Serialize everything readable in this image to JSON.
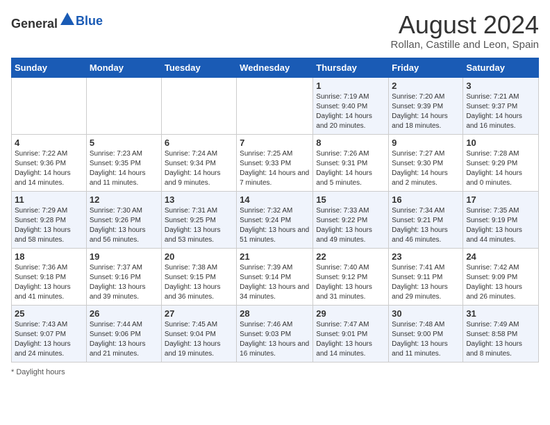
{
  "header": {
    "logo_general": "General",
    "logo_blue": "Blue",
    "month_year": "August 2024",
    "location": "Rollan, Castille and Leon, Spain"
  },
  "days_of_week": [
    "Sunday",
    "Monday",
    "Tuesday",
    "Wednesday",
    "Thursday",
    "Friday",
    "Saturday"
  ],
  "weeks": [
    [
      {
        "day": "",
        "info": ""
      },
      {
        "day": "",
        "info": ""
      },
      {
        "day": "",
        "info": ""
      },
      {
        "day": "",
        "info": ""
      },
      {
        "day": "1",
        "info": "Sunrise: 7:19 AM\nSunset: 9:40 PM\nDaylight: 14 hours and 20 minutes."
      },
      {
        "day": "2",
        "info": "Sunrise: 7:20 AM\nSunset: 9:39 PM\nDaylight: 14 hours and 18 minutes."
      },
      {
        "day": "3",
        "info": "Sunrise: 7:21 AM\nSunset: 9:37 PM\nDaylight: 14 hours and 16 minutes."
      }
    ],
    [
      {
        "day": "4",
        "info": "Sunrise: 7:22 AM\nSunset: 9:36 PM\nDaylight: 14 hours and 14 minutes."
      },
      {
        "day": "5",
        "info": "Sunrise: 7:23 AM\nSunset: 9:35 PM\nDaylight: 14 hours and 11 minutes."
      },
      {
        "day": "6",
        "info": "Sunrise: 7:24 AM\nSunset: 9:34 PM\nDaylight: 14 hours and 9 minutes."
      },
      {
        "day": "7",
        "info": "Sunrise: 7:25 AM\nSunset: 9:33 PM\nDaylight: 14 hours and 7 minutes."
      },
      {
        "day": "8",
        "info": "Sunrise: 7:26 AM\nSunset: 9:31 PM\nDaylight: 14 hours and 5 minutes."
      },
      {
        "day": "9",
        "info": "Sunrise: 7:27 AM\nSunset: 9:30 PM\nDaylight: 14 hours and 2 minutes."
      },
      {
        "day": "10",
        "info": "Sunrise: 7:28 AM\nSunset: 9:29 PM\nDaylight: 14 hours and 0 minutes."
      }
    ],
    [
      {
        "day": "11",
        "info": "Sunrise: 7:29 AM\nSunset: 9:28 PM\nDaylight: 13 hours and 58 minutes."
      },
      {
        "day": "12",
        "info": "Sunrise: 7:30 AM\nSunset: 9:26 PM\nDaylight: 13 hours and 56 minutes."
      },
      {
        "day": "13",
        "info": "Sunrise: 7:31 AM\nSunset: 9:25 PM\nDaylight: 13 hours and 53 minutes."
      },
      {
        "day": "14",
        "info": "Sunrise: 7:32 AM\nSunset: 9:24 PM\nDaylight: 13 hours and 51 minutes."
      },
      {
        "day": "15",
        "info": "Sunrise: 7:33 AM\nSunset: 9:22 PM\nDaylight: 13 hours and 49 minutes."
      },
      {
        "day": "16",
        "info": "Sunrise: 7:34 AM\nSunset: 9:21 PM\nDaylight: 13 hours and 46 minutes."
      },
      {
        "day": "17",
        "info": "Sunrise: 7:35 AM\nSunset: 9:19 PM\nDaylight: 13 hours and 44 minutes."
      }
    ],
    [
      {
        "day": "18",
        "info": "Sunrise: 7:36 AM\nSunset: 9:18 PM\nDaylight: 13 hours and 41 minutes."
      },
      {
        "day": "19",
        "info": "Sunrise: 7:37 AM\nSunset: 9:16 PM\nDaylight: 13 hours and 39 minutes."
      },
      {
        "day": "20",
        "info": "Sunrise: 7:38 AM\nSunset: 9:15 PM\nDaylight: 13 hours and 36 minutes."
      },
      {
        "day": "21",
        "info": "Sunrise: 7:39 AM\nSunset: 9:14 PM\nDaylight: 13 hours and 34 minutes."
      },
      {
        "day": "22",
        "info": "Sunrise: 7:40 AM\nSunset: 9:12 PM\nDaylight: 13 hours and 31 minutes."
      },
      {
        "day": "23",
        "info": "Sunrise: 7:41 AM\nSunset: 9:11 PM\nDaylight: 13 hours and 29 minutes."
      },
      {
        "day": "24",
        "info": "Sunrise: 7:42 AM\nSunset: 9:09 PM\nDaylight: 13 hours and 26 minutes."
      }
    ],
    [
      {
        "day": "25",
        "info": "Sunrise: 7:43 AM\nSunset: 9:07 PM\nDaylight: 13 hours and 24 minutes."
      },
      {
        "day": "26",
        "info": "Sunrise: 7:44 AM\nSunset: 9:06 PM\nDaylight: 13 hours and 21 minutes."
      },
      {
        "day": "27",
        "info": "Sunrise: 7:45 AM\nSunset: 9:04 PM\nDaylight: 13 hours and 19 minutes."
      },
      {
        "day": "28",
        "info": "Sunrise: 7:46 AM\nSunset: 9:03 PM\nDaylight: 13 hours and 16 minutes."
      },
      {
        "day": "29",
        "info": "Sunrise: 7:47 AM\nSunset: 9:01 PM\nDaylight: 13 hours and 14 minutes."
      },
      {
        "day": "30",
        "info": "Sunrise: 7:48 AM\nSunset: 9:00 PM\nDaylight: 13 hours and 11 minutes."
      },
      {
        "day": "31",
        "info": "Sunrise: 7:49 AM\nSunset: 8:58 PM\nDaylight: 13 hours and 8 minutes."
      }
    ]
  ],
  "footer": {
    "note": "Daylight hours"
  }
}
